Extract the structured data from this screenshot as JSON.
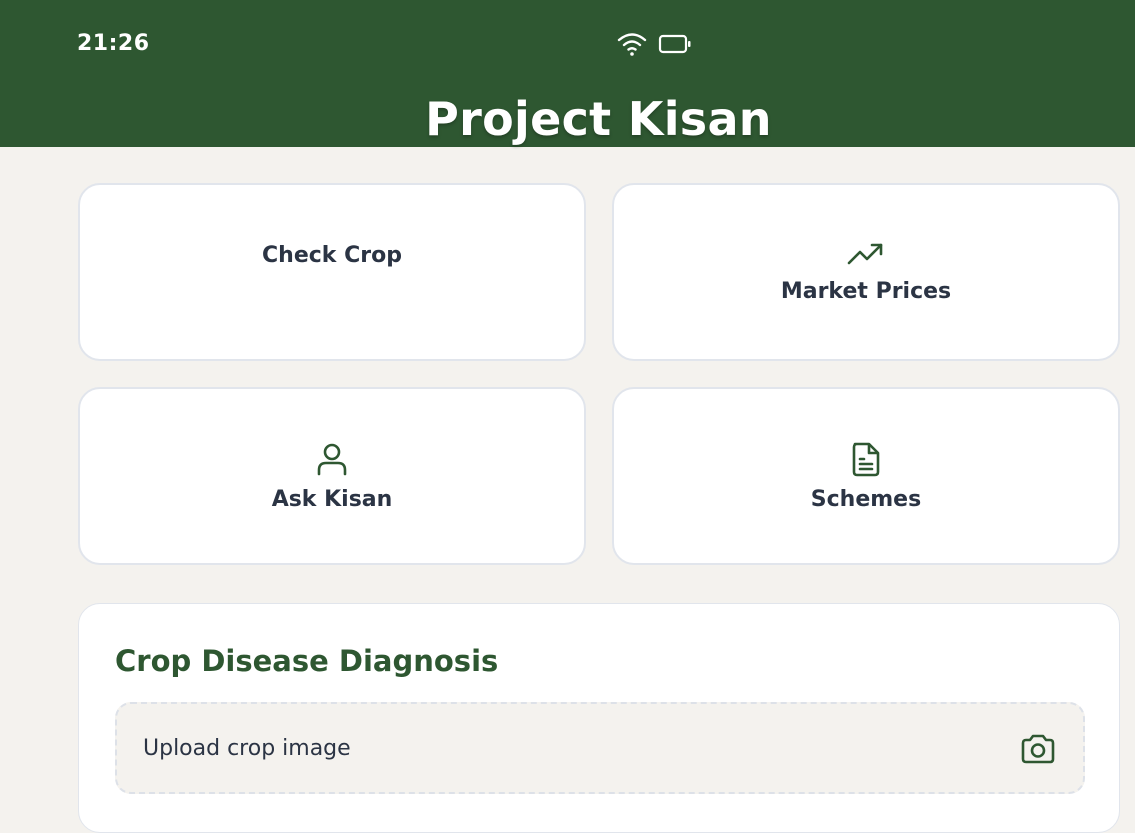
{
  "status_bar": {
    "time": "21:26",
    "icons": [
      "wifi-icon",
      "battery-icon"
    ]
  },
  "app": {
    "title": "Project Kisan"
  },
  "colors": {
    "primary_green": "#2e5731",
    "background": "#f4f2ee",
    "card_border": "#e1e5ec",
    "label_text": "#2b3444"
  },
  "quick_actions": [
    {
      "label": "Check Crop",
      "icon": "none"
    },
    {
      "label": "Market Prices",
      "icon": "trending-up-icon"
    },
    {
      "label": "Ask Kisan",
      "icon": "user-icon"
    },
    {
      "label": "Schemes",
      "icon": "document-icon"
    }
  ],
  "diagnosis": {
    "title": "Crop Disease Diagnosis",
    "upload_label": "Upload crop image",
    "upload_icon": "camera-icon"
  }
}
